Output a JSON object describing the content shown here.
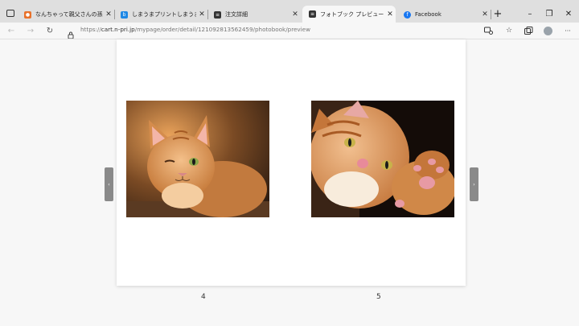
{
  "tabs": [
    {
      "label": "なんちゃって親父さんの孫日記 -"
    },
    {
      "label": "しまうまプリントしまうま - Bing"
    },
    {
      "label": "注文詳細"
    },
    {
      "label": "フォトブック プレビュー"
    },
    {
      "label": "Facebook"
    }
  ],
  "icons": {
    "tab_actions": "tab-actions-icon",
    "new_tab": "+",
    "minimize": "–",
    "maximize": "❐",
    "close": "✕",
    "back": "←",
    "forward": "→",
    "reload": "↻",
    "lock": "lock-icon",
    "more": "···"
  },
  "address": {
    "url_prefix": "https://",
    "url_host": "cart.n-pri.jp",
    "url_path": "/mypage/order/detail/121092813562459/photobook/preview"
  },
  "viewer": {
    "prev_arrow": "‹",
    "next_arrow": "›",
    "left_page_number": "4",
    "right_page_number": "5"
  }
}
